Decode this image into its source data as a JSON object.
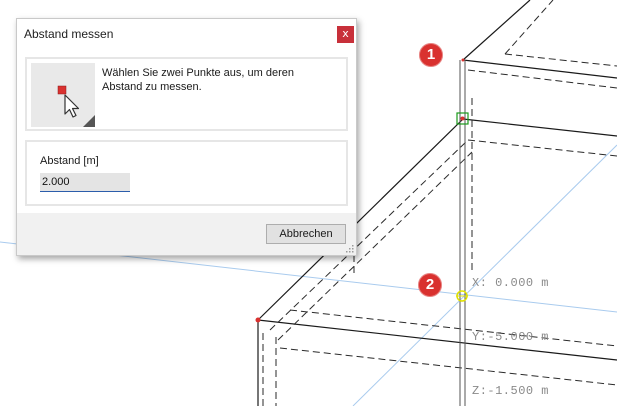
{
  "dialog": {
    "title": "Abstand messen",
    "close_label": "x",
    "instruction": "Wählen Sie zwei Punkte aus, um deren Abstand zu messen.",
    "field_label": "Abstand [m]",
    "distance_value": "2.000",
    "cancel_label": "Abbrechen",
    "tool_icon": "pick-point-cursor-icon"
  },
  "viewport": {
    "coord_x": "X: 0.000 m",
    "coord_y": "Y:-5.000 m",
    "coord_z": "Z:-1.500 m",
    "marker_1": "1",
    "marker_2": "2"
  },
  "colors": {
    "marker_red": "#d9312f",
    "snap_green": "#1a9a1a",
    "snap_yellow": "#e6e600",
    "axis_blue": "#9ec3ea",
    "close_button": "#c8303a"
  }
}
